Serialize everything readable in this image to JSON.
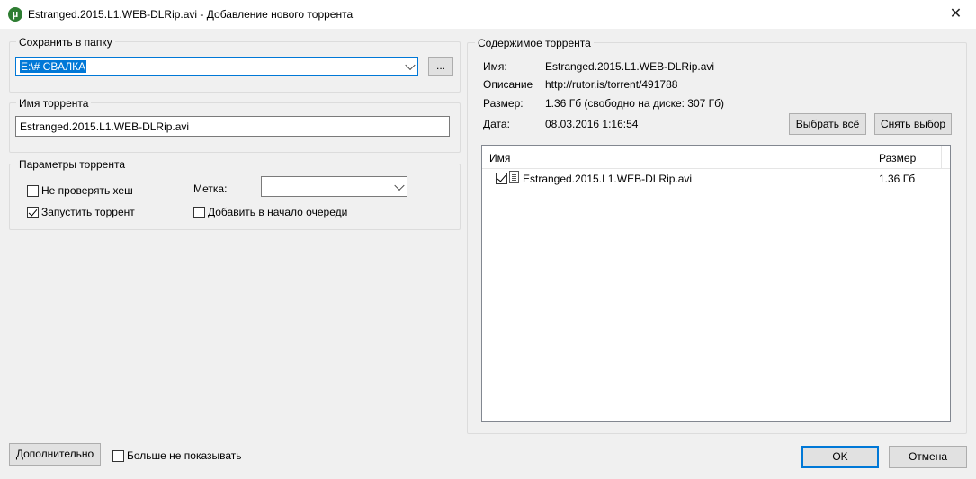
{
  "window": {
    "title": "Estranged.2015.L1.WEB-DLRip.avi - Добавление нового торрента",
    "close_glyph": "✕",
    "app_icon_glyph": "µ"
  },
  "save_folder": {
    "legend": "Сохранить в папку",
    "value": "E:\\# СВАЛКА",
    "browse_label": "..."
  },
  "torrent_name": {
    "legend": "Имя торрента",
    "value": "Estranged.2015.L1.WEB-DLRip.avi"
  },
  "options": {
    "legend": "Параметры торрента",
    "skip_hash_check": {
      "label": "Не проверять хеш",
      "checked": false
    },
    "start_torrent": {
      "label": "Запустить торрент",
      "checked": true
    },
    "label_field_label": "Метка:",
    "label_value": "",
    "add_to_top": {
      "label": "Добавить в начало очереди",
      "checked": false
    }
  },
  "contents": {
    "legend": "Содержимое торрента",
    "name_label": "Имя:",
    "name_value": "Estranged.2015.L1.WEB-DLRip.avi",
    "description_label": "Описание",
    "description_value": "http://rutor.is/torrent/491788",
    "size_label": "Размер:",
    "size_value": "1.36 Гб (свободно на диске: 307 Гб)",
    "date_label": "Дата:",
    "date_value": "08.03.2016 1:16:54",
    "select_all_label": "Выбрать всё",
    "deselect_label": "Снять выбор",
    "columns": [
      "Имя",
      "Размер"
    ],
    "files": [
      {
        "name": "Estranged.2015.L1.WEB-DLRip.avi",
        "size": "1.36 Гб",
        "checked": true
      }
    ]
  },
  "footer": {
    "advanced_label": "Дополнительно",
    "dont_show_label": "Больше не показывать",
    "ok_label": "OK",
    "cancel_label": "Отмена"
  },
  "colors": {
    "selection": "#0078d7",
    "app_icon": "#2e7d32",
    "window_bg": "#f0f0f0"
  }
}
